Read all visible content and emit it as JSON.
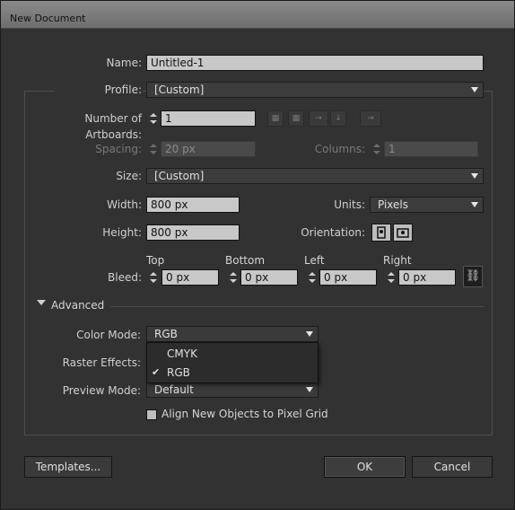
{
  "window": {
    "title": "New Document"
  },
  "name": {
    "label": "Name:",
    "value": "Untitled-1"
  },
  "profile": {
    "label": "Profile:",
    "value": "[Custom]"
  },
  "artboards": {
    "label": "Number of Artboards:",
    "value": "1"
  },
  "spacing": {
    "label": "Spacing:",
    "value": "20 px"
  },
  "columns": {
    "label": "Columns:",
    "value": "1"
  },
  "size": {
    "label": "Size:",
    "value": "[Custom]"
  },
  "width": {
    "label": "Width:",
    "value": "800 px"
  },
  "units": {
    "label": "Units:",
    "value": "Pixels"
  },
  "height": {
    "label": "Height:",
    "value": "800 px"
  },
  "orientation": {
    "label": "Orientation:"
  },
  "bleed": {
    "label": "Bleed:",
    "top": {
      "label": "Top",
      "value": "0 px"
    },
    "bottom": {
      "label": "Bottom",
      "value": "0 px"
    },
    "left": {
      "label": "Left",
      "value": "0 px"
    },
    "right": {
      "label": "Right",
      "value": "0 px"
    }
  },
  "advanced": {
    "label": "Advanced"
  },
  "color_mode": {
    "label": "Color Mode:",
    "value": "RGB",
    "options": [
      "CMYK",
      "RGB"
    ],
    "selected": "RGB"
  },
  "raster_effects": {
    "label": "Raster Effects:"
  },
  "preview_mode": {
    "label": "Preview Mode:",
    "value": "Default"
  },
  "align_pixel_grid": {
    "label": "Align New Objects to Pixel Grid",
    "checked": false
  },
  "buttons": {
    "templates": "Templates...",
    "ok": "OK",
    "cancel": "Cancel"
  },
  "colors": {
    "background": "#323232",
    "input": "#c8c8c8",
    "border": "#111111"
  }
}
